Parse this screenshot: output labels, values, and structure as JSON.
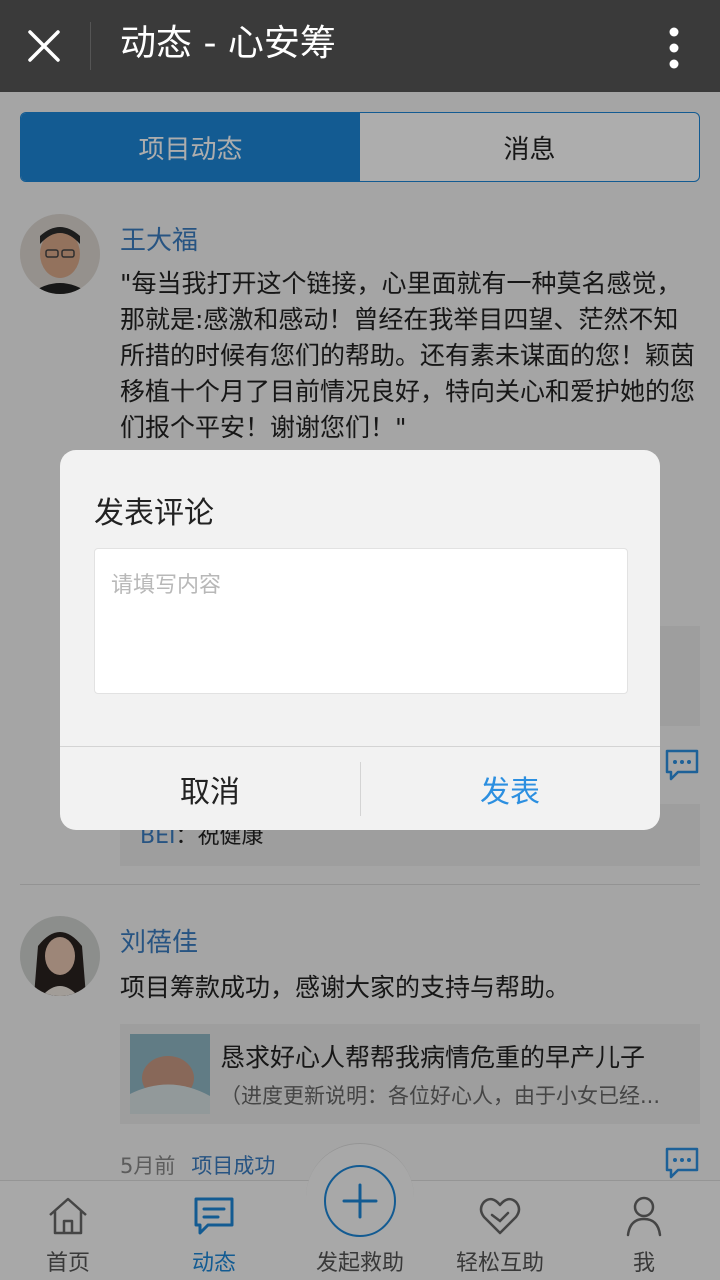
{
  "header": {
    "title": "动态 - 心安筹",
    "close_icon": "close-icon",
    "more_icon": "more-vertical-icon"
  },
  "tabs": [
    {
      "label": "项目动态",
      "active": true
    },
    {
      "label": "消息",
      "active": false
    }
  ],
  "posts": [
    {
      "author": "王大福",
      "text": "\"每当我打开这个链接，心里面就有一种莫名感觉，那就是:感激和感动！曾经在我举目四望、茫然不知所措的时候有您们的帮助。还有素未谋面的您！颖茵移植十个月了目前情况良好，特向关心和爱护她的您们报个平安！谢谢您们！\"",
      "comment_user": "BEI",
      "comment_text": "：祝健康"
    },
    {
      "author": "刘蓓佳",
      "text": "项目筹款成功，感谢大家的支持与帮助。",
      "project_title": "恳求好心人帮帮我病情危重的早产儿子",
      "project_desc": "（进度更新说明：各位好心人，由于小女已经...",
      "time": "5月前",
      "tag": "项目成功"
    }
  ],
  "dialog": {
    "title": "发表评论",
    "placeholder": "请填写内容",
    "cancel_label": "取消",
    "submit_label": "发表"
  },
  "bottom_nav": [
    {
      "label": "首页",
      "icon": "home-icon",
      "active": false
    },
    {
      "label": "动态",
      "icon": "message-icon",
      "active": true
    },
    {
      "label": "发起救助",
      "icon": "plus-circle-icon",
      "active": false
    },
    {
      "label": "轻松互助",
      "icon": "heart-icon",
      "active": false
    },
    {
      "label": "我",
      "icon": "user-icon",
      "active": false
    }
  ],
  "colors": {
    "accent": "#1c86d8",
    "link": "#3a7cc0",
    "topbar": "#3a3a3a"
  }
}
